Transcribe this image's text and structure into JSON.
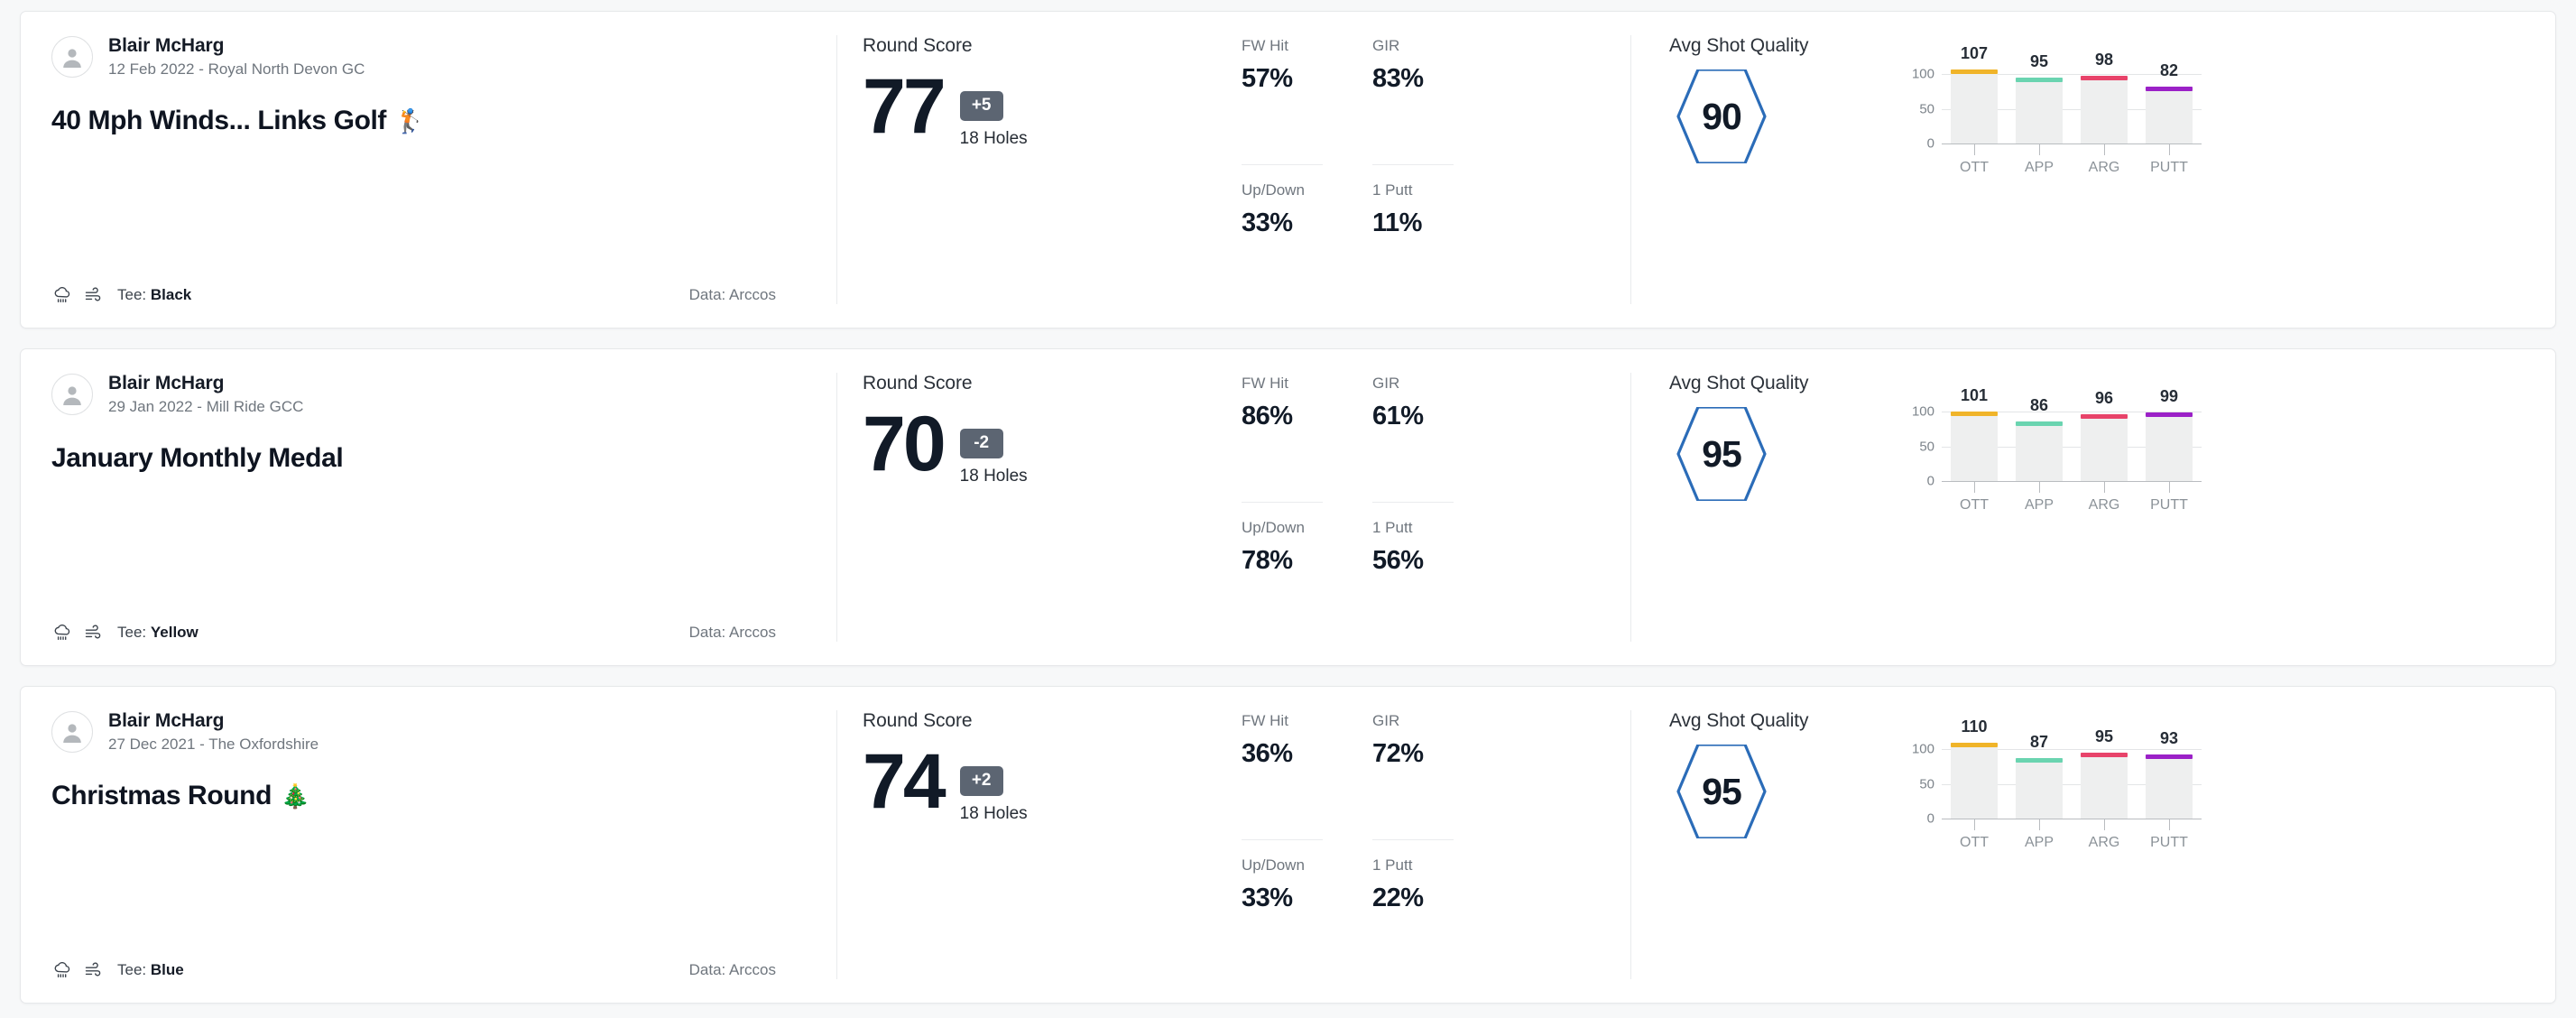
{
  "labels": {
    "round_score": "Round Score",
    "holes": "18 Holes",
    "fw_hit": "FW Hit",
    "gir": "GIR",
    "up_down": "Up/Down",
    "one_putt": "1 Putt",
    "avg_shot_quality": "Avg Shot Quality",
    "tee_prefix": "Tee: ",
    "data_source": "Data: Arccos"
  },
  "colors": {
    "hexagon": "#2b6cb8",
    "badge_bg": "#5c6572",
    "bar_track": "#eeefef",
    "ott": "#f0b429",
    "app": "#6ad4b0",
    "arg": "#e8436a",
    "putt": "#9b21c7"
  },
  "chart_axis": {
    "yticks": [
      "100",
      "50",
      "0"
    ],
    "categories": [
      "OTT",
      "APP",
      "ARG",
      "PUTT"
    ]
  },
  "rounds": [
    {
      "user": "Blair McHarg",
      "meta": "12 Feb 2022 - Royal North Devon GC",
      "title": "40 Mph Winds... Links Golf",
      "title_emoji": "🏌️",
      "tee": "Black",
      "score": "77",
      "to_par": "+5",
      "fw_hit": "57%",
      "gir": "83%",
      "up_down": "33%",
      "one_putt": "11%",
      "avg_quality": "90",
      "chart_data": {
        "type": "bar",
        "title": "Avg Shot Quality",
        "categories": [
          "OTT",
          "APP",
          "ARG",
          "PUTT"
        ],
        "values": [
          107,
          95,
          98,
          82
        ],
        "colors": [
          "#f0b429",
          "#6ad4b0",
          "#e8436a",
          "#9b21c7"
        ],
        "ylim": [
          0,
          120
        ],
        "yticks": [
          0,
          50,
          100
        ],
        "xlabel": "",
        "ylabel": "",
        "grid": true,
        "legend": "none"
      }
    },
    {
      "user": "Blair McHarg",
      "meta": "29 Jan 2022 - Mill Ride GCC",
      "title": "January Monthly Medal",
      "title_emoji": "",
      "tee": "Yellow",
      "score": "70",
      "to_par": "-2",
      "fw_hit": "86%",
      "gir": "61%",
      "up_down": "78%",
      "one_putt": "56%",
      "avg_quality": "95",
      "chart_data": {
        "type": "bar",
        "title": "Avg Shot Quality",
        "categories": [
          "OTT",
          "APP",
          "ARG",
          "PUTT"
        ],
        "values": [
          101,
          86,
          96,
          99
        ],
        "colors": [
          "#f0b429",
          "#6ad4b0",
          "#e8436a",
          "#9b21c7"
        ],
        "ylim": [
          0,
          120
        ],
        "yticks": [
          0,
          50,
          100
        ],
        "xlabel": "",
        "ylabel": "",
        "grid": true,
        "legend": "none"
      }
    },
    {
      "user": "Blair McHarg",
      "meta": "27 Dec 2021 - The Oxfordshire",
      "title": "Christmas Round",
      "title_emoji": "🎄",
      "tee": "Blue",
      "score": "74",
      "to_par": "+2",
      "fw_hit": "36%",
      "gir": "72%",
      "up_down": "33%",
      "one_putt": "22%",
      "avg_quality": "95",
      "chart_data": {
        "type": "bar",
        "title": "Avg Shot Quality",
        "categories": [
          "OTT",
          "APP",
          "ARG",
          "PUTT"
        ],
        "values": [
          110,
          87,
          95,
          93
        ],
        "colors": [
          "#f0b429",
          "#6ad4b0",
          "#e8436a",
          "#9b21c7"
        ],
        "ylim": [
          0,
          120
        ],
        "yticks": [
          0,
          50,
          100
        ],
        "xlabel": "",
        "ylabel": "",
        "grid": true,
        "legend": "none"
      }
    }
  ]
}
